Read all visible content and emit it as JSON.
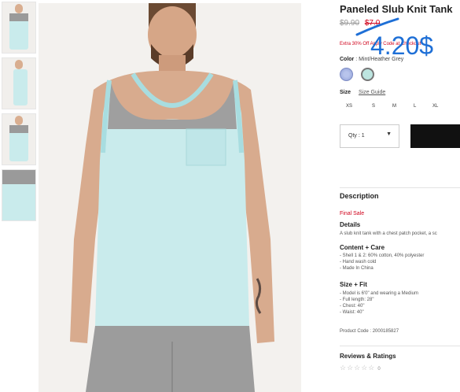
{
  "product": {
    "title": "Paneled Slub Knit Tank",
    "original_price": "$9.90",
    "sale_price": "$7.0",
    "promo_text": "Extra 30% Off Apply Code at Checkout",
    "overlay_price": "4.20$",
    "color_label": "Color",
    "color_value": ": Mint/Heather Grey",
    "swatches": [
      "blue",
      "mint"
    ],
    "size_label": "Size",
    "size_guide": "Size Guide",
    "sizes": [
      "XS",
      "S",
      "M",
      "L",
      "XL"
    ],
    "qty_label": "Qty : 1",
    "qty_caret": "▼"
  },
  "description": {
    "heading": "Description",
    "final_sale": "Final Sale",
    "details_heading": "Details",
    "details_text": "A slub knit tank with a chest patch pocket, a sc",
    "content_heading": "Content + Care",
    "content_lines": [
      "- Shell 1 & 2: 60% cotton, 40% polyester",
      "- Hand wash cold",
      "- Made In China"
    ],
    "fit_heading": "Size + Fit",
    "fit_lines": [
      "- Model is 6'0\" and wearing a Medium",
      "- Full length: 28\"",
      "- Chest: 40\"",
      "- Waist: 40\""
    ],
    "product_code": "Product Code : 2000185827"
  },
  "reviews": {
    "heading": "Reviews & Ratings",
    "stars": "☆☆☆☆☆",
    "count": "0"
  },
  "colors": {
    "accent_blue": "#1e6fd6",
    "sale_red": "#d0021b",
    "tank_mint": "#c9ebec",
    "tank_grey": "#9a9a9a"
  }
}
